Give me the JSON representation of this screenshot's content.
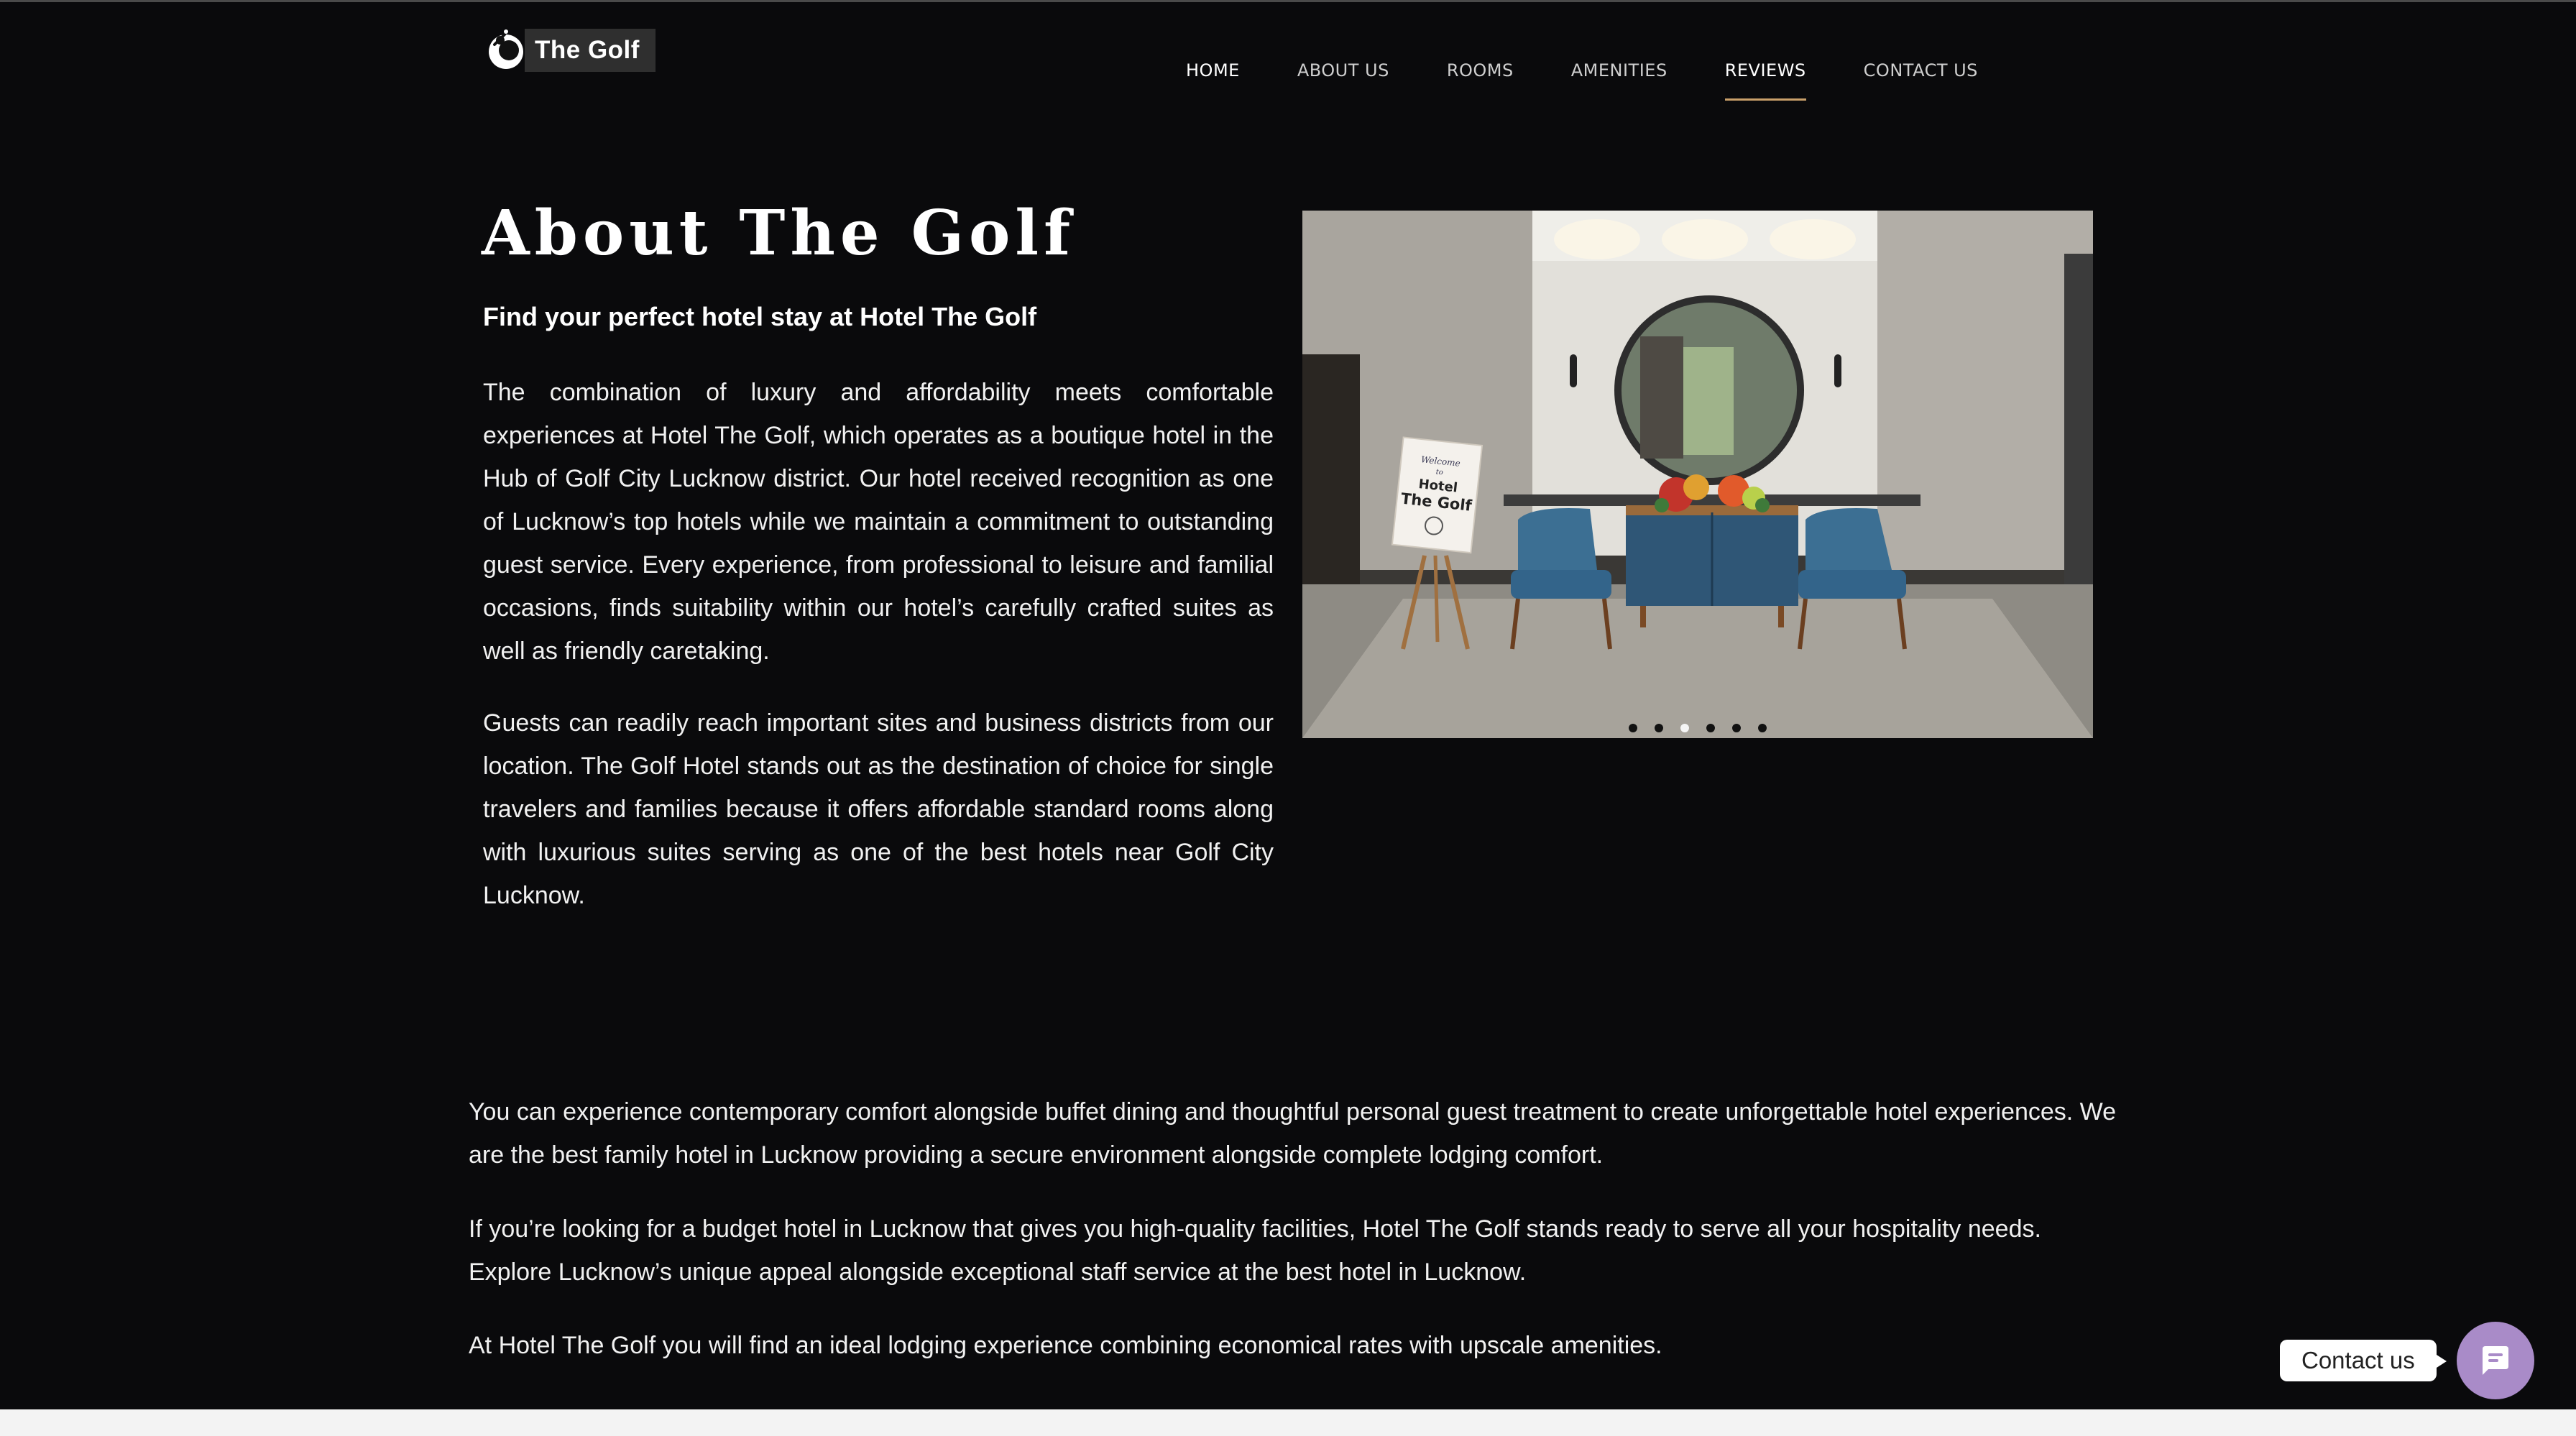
{
  "logo": {
    "text": "The Golf",
    "icon": "golfer-icon"
  },
  "nav": {
    "items": [
      {
        "label": "HOME"
      },
      {
        "label": "ABOUT US"
      },
      {
        "label": "ROOMS"
      },
      {
        "label": "AMENITIES"
      },
      {
        "label": "REVIEWS",
        "active": true
      },
      {
        "label": "CONTACT US"
      }
    ]
  },
  "about": {
    "title": "About The Golf",
    "subtitle": "Find your perfect hotel stay at Hotel The Golf",
    "paragraph1": "The combination of luxury and affordability meets comfortable experiences at Hotel The Golf, which operates as a boutique hotel in the Hub of Golf City Lucknow district. Our hotel received recognition as one of Lucknow’s top hotels while we maintain a commitment to outstanding guest service. Every experience, from professional to leisure and familial occasions, finds suitability within our hotel’s carefully crafted suites as well as friendly caretaking.",
    "paragraph2": "Guests can readily reach important sites and business districts from our location. The Golf Hotel stands out as the destination of choice for single travelers and families because it offers affordable standard rooms along with luxurious suites serving as one of the best hotels near Golf City Lucknow."
  },
  "slider": {
    "sign_line1": "Welcome",
    "sign_line2": "to",
    "sign_line3": "Hotel",
    "sign_line4": "The Golf",
    "slide_count": 6,
    "active_slide": 3
  },
  "more": {
    "paragraph1": "You can experience contemporary comfort alongside buffet dining and thoughtful personal guest treatment to create unforgettable hotel experiences. We are the best family hotel in Lucknow providing a secure environment alongside complete lodging comfort.",
    "paragraph2": "If you’re looking for a budget hotel in Lucknow that gives you high-quality facilities, Hotel The Golf stands ready to serve all your hospitality needs. Explore Lucknow’s unique appeal alongside exceptional staff service at the best hotel in Lucknow.",
    "paragraph3": "At Hotel The Golf you will find an ideal lodging experience combining economical rates with upscale amenities."
  },
  "contact_widget": {
    "label": "Contact us",
    "icon": "chat-icon",
    "color": "#a98bc8"
  },
  "colors": {
    "background": "#0a0a0c",
    "nav_underline": "#c9a06a"
  }
}
